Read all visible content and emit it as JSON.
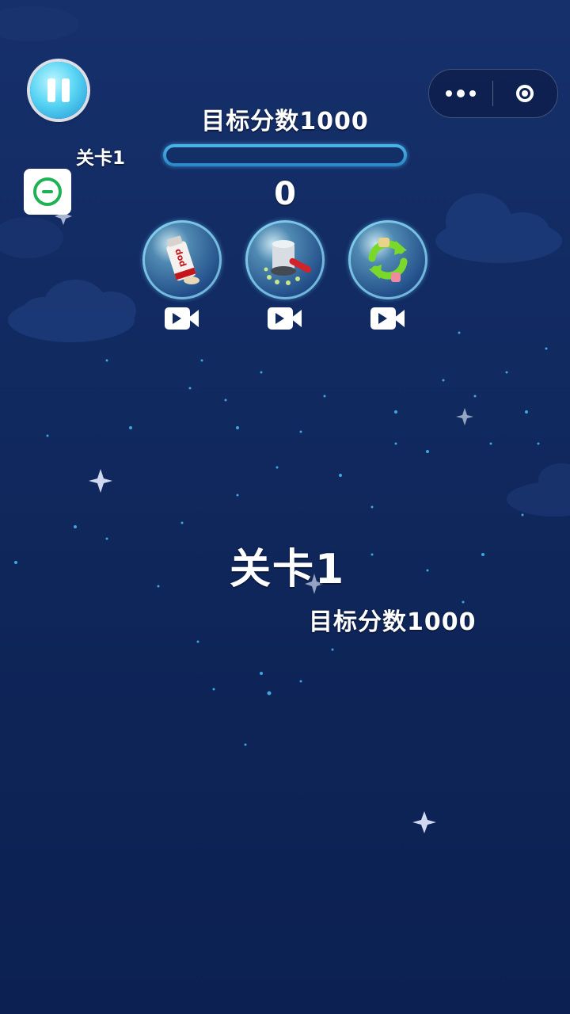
{
  "hud": {
    "target_score_text": "目标分数1000",
    "level_text": "关卡1",
    "current_score": "0",
    "progress_fraction": 0.0
  },
  "overlay": {
    "level_title": "关卡1",
    "target_score_text": "目标分数1000"
  },
  "powerups": [
    {
      "name": "pop-spray",
      "icon": "pop-spray-icon",
      "label": "pop",
      "action": "video-ad"
    },
    {
      "name": "hammer",
      "icon": "hammer-icon",
      "action": "video-ad"
    },
    {
      "name": "refresh",
      "icon": "refresh-icon",
      "action": "video-ad"
    }
  ],
  "icons": {
    "pause": "pause-icon",
    "more": "more-dots-icon",
    "close": "target-circle-icon",
    "chat": "chat-bubble-icon",
    "video": "video-camera-icon"
  },
  "colors": {
    "background_top": "#16306c",
    "background_bottom": "#0c2151",
    "accent_cyan": "#4bb5e8",
    "chat_green": "#1db254"
  }
}
